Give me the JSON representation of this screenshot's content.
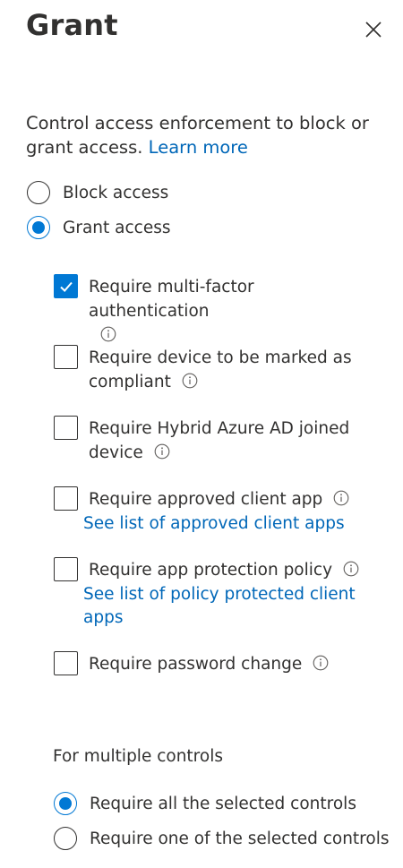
{
  "panel": {
    "title": "Grant",
    "intro_text": "Control access enforcement to block or grant access.",
    "learn_more": "Learn more"
  },
  "access_mode": {
    "options": [
      {
        "label": "Block access",
        "selected": false
      },
      {
        "label": "Grant access",
        "selected": true
      }
    ]
  },
  "controls": [
    {
      "label": "Require multi-factor authentication",
      "checked": true,
      "info_icon": "info-icon"
    },
    {
      "label": "Require device to be marked as compliant",
      "checked": false,
      "info_icon": "info-icon"
    },
    {
      "label": "Require Hybrid Azure AD joined device",
      "checked": false,
      "info_icon": "info-icon"
    },
    {
      "label": "Require approved client app",
      "checked": false,
      "info_icon": "info-icon",
      "link": "See list of approved client apps"
    },
    {
      "label": "Require app protection policy",
      "checked": false,
      "info_icon": "info-icon",
      "link": "See list of policy protected client apps"
    },
    {
      "label": "Require password change",
      "checked": false,
      "info_icon": "info-icon"
    }
  ],
  "multiple_controls": {
    "heading": "For multiple controls",
    "options": [
      {
        "label": "Require all the selected controls",
        "selected": true
      },
      {
        "label": "Require one of the selected controls",
        "selected": false
      }
    ]
  },
  "colors": {
    "accent": "#0078d4",
    "link": "#0067b8",
    "text": "#323130"
  }
}
